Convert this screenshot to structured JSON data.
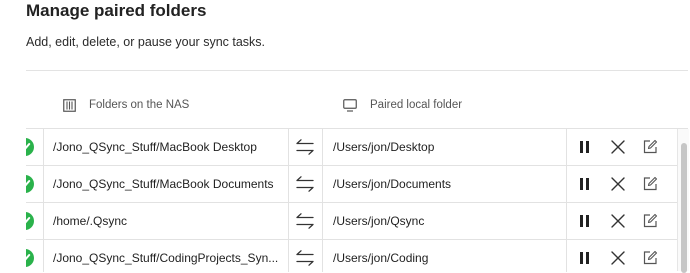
{
  "page": {
    "title": "Manage paired folders",
    "subtitle": "Add, edit, delete, or pause your sync tasks."
  },
  "columns": {
    "nas": {
      "label": "Folders on the NAS",
      "icon": "nas-server-icon"
    },
    "local": {
      "label": "Paired local folder",
      "icon": "monitor-icon"
    }
  },
  "rows": [
    {
      "nas_path": "/Jono_QSync_Stuff/MacBook Desktop",
      "local_path": "/Users/jon/Desktop",
      "status": "synced"
    },
    {
      "nas_path": "/Jono_QSync_Stuff/MacBook Documents",
      "local_path": "/Users/jon/Documents",
      "status": "synced"
    },
    {
      "nas_path": "/home/.Qsync",
      "local_path": "/Users/jon/Qsync",
      "status": "synced"
    },
    {
      "nas_path": "/Jono_QSync_Stuff/CodingProjects_Syn...",
      "local_path": "/Users/jon/Coding",
      "status": "synced"
    }
  ],
  "row_icons": {
    "status": "checkmark-icon",
    "sync_direction": "sync-arrows-icon",
    "pause": "pause-icon",
    "remove": "close-icon",
    "edit": "edit-icon"
  },
  "colors": {
    "status_green": "#2ab24b",
    "divider": "#e2e2e2",
    "text": "#1f1f1f"
  }
}
